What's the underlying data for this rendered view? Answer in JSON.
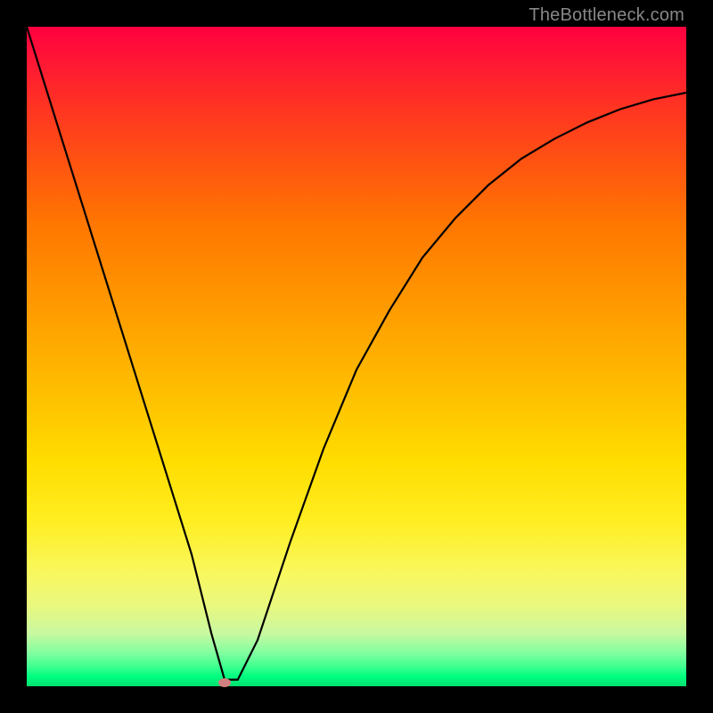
{
  "watermark": "TheBottleneck.com",
  "chart_data": {
    "type": "line",
    "title": "",
    "xlabel": "",
    "ylabel": "",
    "xlim": [
      0,
      100
    ],
    "ylim": [
      0,
      100
    ],
    "grid": false,
    "legend": false,
    "background": "rainbow-vertical-gradient",
    "series": [
      {
        "name": "bottleneck-curve",
        "x": [
          0,
          5,
          10,
          15,
          20,
          25,
          28,
          30,
          32,
          35,
          40,
          45,
          50,
          55,
          60,
          65,
          70,
          75,
          80,
          85,
          90,
          95,
          100
        ],
        "y": [
          100,
          84,
          68,
          52,
          36,
          20,
          8,
          1,
          1,
          7,
          22,
          36,
          48,
          57,
          65,
          71,
          76,
          80,
          83,
          85.5,
          87.5,
          89,
          90
        ]
      }
    ],
    "marker": {
      "name": "optimal-point",
      "x": 30,
      "y": 0.5,
      "color": "#d08080"
    },
    "gradient_stops": [
      {
        "pct": 0,
        "color": "#ff0040"
      },
      {
        "pct": 30,
        "color": "#ff7700"
      },
      {
        "pct": 66,
        "color": "#ffdd00"
      },
      {
        "pct": 95,
        "color": "#80ffa0"
      },
      {
        "pct": 100,
        "color": "#00e070"
      }
    ]
  }
}
